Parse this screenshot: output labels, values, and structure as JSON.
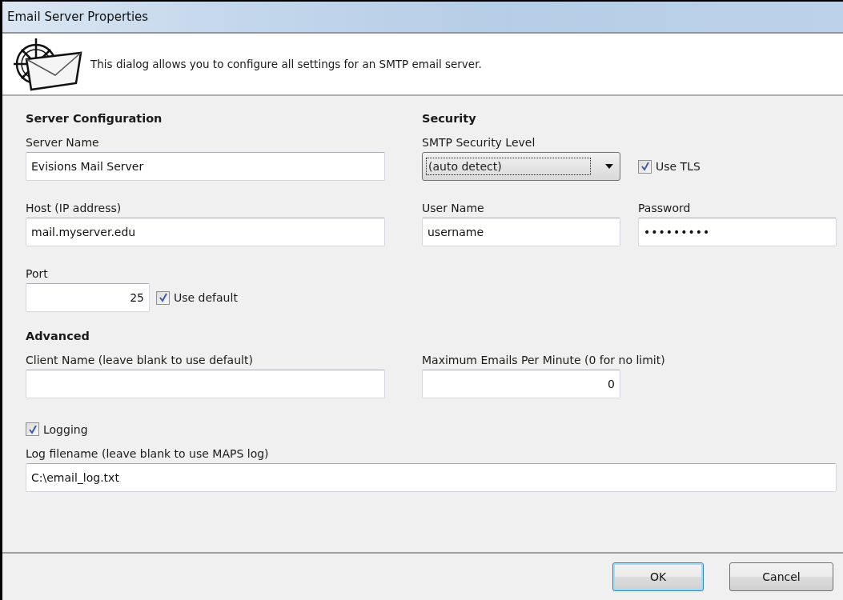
{
  "window": {
    "title": "Email Server Properties"
  },
  "header": {
    "text": "This dialog allows you to configure all settings for an SMTP email server."
  },
  "server_configuration": {
    "heading": "Server Configuration",
    "server_name": {
      "label": "Server Name",
      "value": "Evisions Mail Server"
    },
    "host": {
      "label": "Host (IP address)",
      "value": "mail.myserver.edu"
    },
    "port": {
      "label": "Port",
      "value": "25"
    },
    "use_default": {
      "label": "Use default",
      "checked": true
    }
  },
  "security": {
    "heading": "Security",
    "level": {
      "label": "SMTP Security Level",
      "value": "(auto detect)",
      "focused": true
    },
    "use_tls": {
      "label": "Use TLS",
      "checked": true
    },
    "user_name": {
      "label": "User Name",
      "value": "username"
    },
    "password": {
      "label": "Password",
      "value": "•••••••••"
    }
  },
  "advanced": {
    "heading": "Advanced",
    "client_name": {
      "label": "Client Name (leave blank to use default)"
    },
    "max_emails": {
      "label": "Maximum Emails Per Minute (0 for no limit)",
      "value": "0"
    },
    "logging": {
      "label": "Logging",
      "checked": true
    },
    "log_filename": {
      "label": "Log filename (leave blank to use MAPS log)",
      "value": "C:\\email_log.txt"
    }
  },
  "buttons": [
    {
      "label": "OK",
      "default": true
    },
    {
      "label": "Cancel",
      "default": false
    }
  ]
}
